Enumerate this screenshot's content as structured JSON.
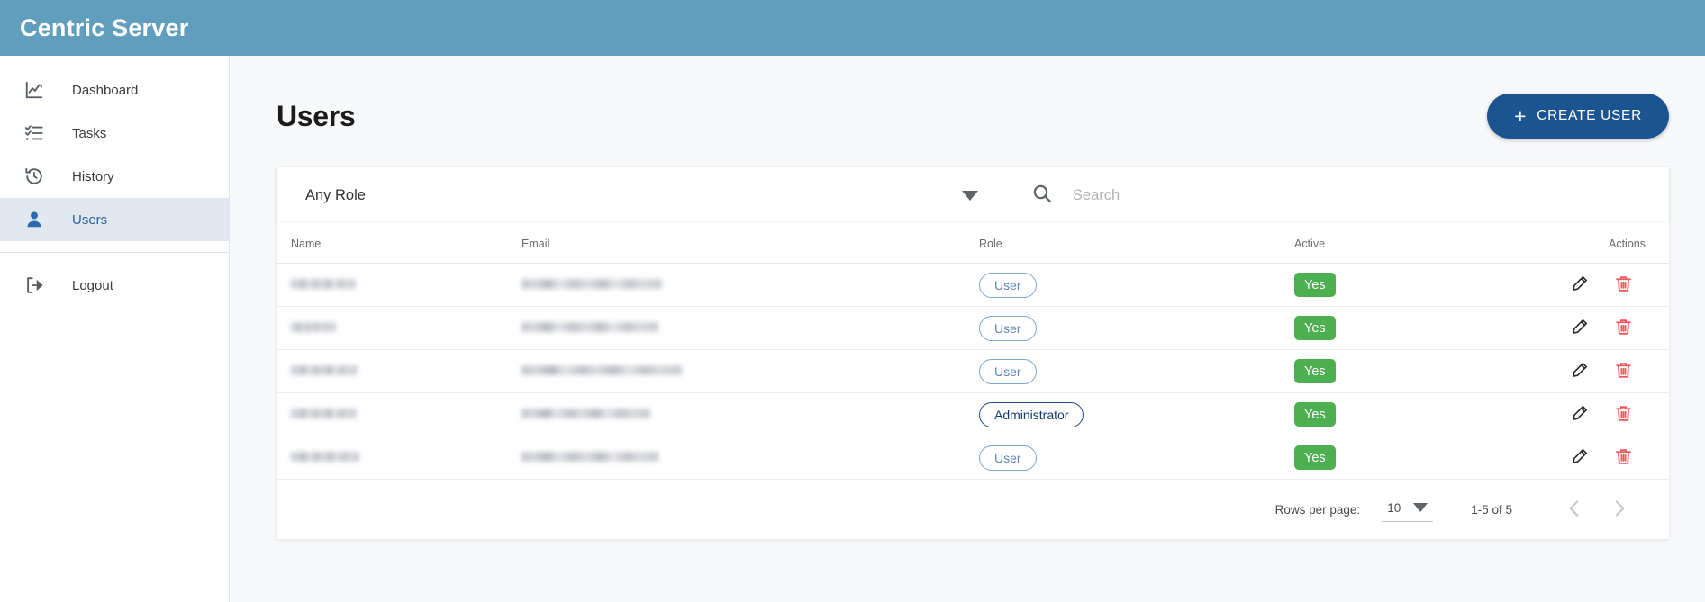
{
  "app": {
    "brand": "Centric Server"
  },
  "sidebar": {
    "items": [
      {
        "label": "Dashboard",
        "icon": "chart-line-icon",
        "active": false
      },
      {
        "label": "Tasks",
        "icon": "checklist-icon",
        "active": false
      },
      {
        "label": "History",
        "icon": "history-clock-icon",
        "active": false
      },
      {
        "label": "Users",
        "icon": "user-icon",
        "active": true
      }
    ],
    "logout": {
      "label": "Logout",
      "icon": "logout-icon"
    }
  },
  "page": {
    "title": "Users",
    "create_button": "CREATE USER",
    "create_icon": "plus-icon"
  },
  "filters": {
    "role": {
      "value": "Any Role",
      "icon": "chevron-down-icon"
    },
    "search": {
      "value": "",
      "placeholder": "Search",
      "icon": "search-icon"
    }
  },
  "table": {
    "columns": [
      "Name",
      "Email",
      "Role",
      "Active",
      "Actions"
    ],
    "rows": [
      {
        "name": "",
        "email": "",
        "role": "User",
        "active": "Yes",
        "name_w": 72,
        "email_w": 156
      },
      {
        "name": "",
        "email": "",
        "role": "User",
        "active": "Yes",
        "name_w": 50,
        "email_w": 152
      },
      {
        "name": "",
        "email": "",
        "role": "User",
        "active": "Yes",
        "name_w": 74,
        "email_w": 178
      },
      {
        "name": "",
        "email": "",
        "role": "Administrator",
        "active": "Yes",
        "name_w": 73,
        "email_w": 143
      },
      {
        "name": "",
        "email": "",
        "role": "User",
        "active": "Yes",
        "name_w": 76,
        "email_w": 152
      }
    ],
    "actions": {
      "edit": "edit-pencil-icon",
      "delete": "delete-trash-icon"
    }
  },
  "pagination": {
    "rows_per_page_label": "Rows per page:",
    "rows_per_page_value": "10",
    "range": "1-5 of 5",
    "prev_icon": "chevron-left-icon",
    "next_icon": "chevron-right-icon"
  },
  "colors": {
    "header_bar": "#619EBE",
    "primary_button": "#1C5391",
    "active_nav": "#E2E8F0",
    "active_badge": "#4CAF50",
    "role_badge": "#7BA7D1",
    "admin_badge": "#1C4E8C",
    "delete_icon": "#F4565A"
  }
}
